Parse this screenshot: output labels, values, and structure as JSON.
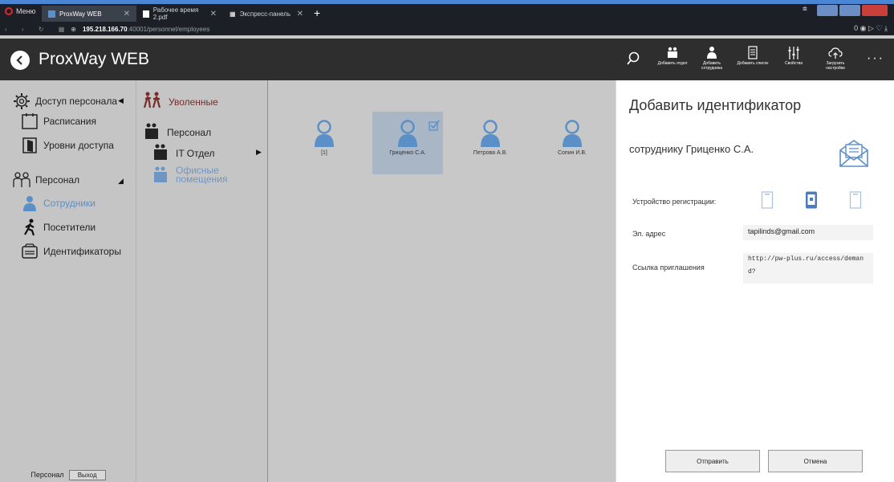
{
  "browser": {
    "menu_label": "Меню",
    "tabs": [
      {
        "label": "ProxWay WEB"
      },
      {
        "label": "Рабочее время 2.pdf"
      },
      {
        "label": "Экспресс-панель"
      }
    ],
    "url_host": "195.218.166.70",
    "url_rest": ":40001/personnel/employees"
  },
  "app": {
    "title": "ProxWay WEB",
    "toolbar": [
      {
        "label": "Добавить отдел",
        "icon": "add-department-icon"
      },
      {
        "label": "Добавить сотрудника",
        "icon": "add-employee-icon"
      },
      {
        "label": "Добавить список",
        "icon": "add-list-icon"
      },
      {
        "label": "Свойства",
        "icon": "properties-icon"
      },
      {
        "label": "Загрузить настройки",
        "icon": "cloud-upload-icon"
      }
    ]
  },
  "sidebar": {
    "access_header": "Доступ персонала",
    "schedules": "Расписания",
    "access_levels": "Уровни доступа",
    "personnel_header": "Персонал",
    "employees": "Сотрудники",
    "visitors": "Посетители",
    "identifiers": "Идентификаторы",
    "footer_label": "Персонал",
    "logout": "Выход"
  },
  "tree": {
    "fired": "Уволенные",
    "personnel": "Персонал",
    "it_dept": "IT Отдел",
    "office": "Офисные помещения"
  },
  "employees": [
    {
      "name": "[1]",
      "selected": false
    },
    {
      "name": "Гриценко С.А.",
      "selected": true
    },
    {
      "name": "Петрова А.В.",
      "selected": false
    },
    {
      "name": "Сопин И.В.",
      "selected": false
    }
  ],
  "panel": {
    "title": "Добавить идентификатор",
    "subtitle": "сотруднику Гриценко С.А.",
    "device_label": "Устройство регистрации:",
    "email_label": "Эл. адрес",
    "email_value": "tapilinds@gmail.com",
    "link_label": "Ссылка приглашения",
    "link_value": "http://pw-plus.ru/access/demand?",
    "send": "Отправить",
    "cancel": "Отмена"
  },
  "colors": {
    "accent": "#5b8fc8",
    "fired": "#7a2b2b",
    "header_bg": "#2e2e2e"
  }
}
